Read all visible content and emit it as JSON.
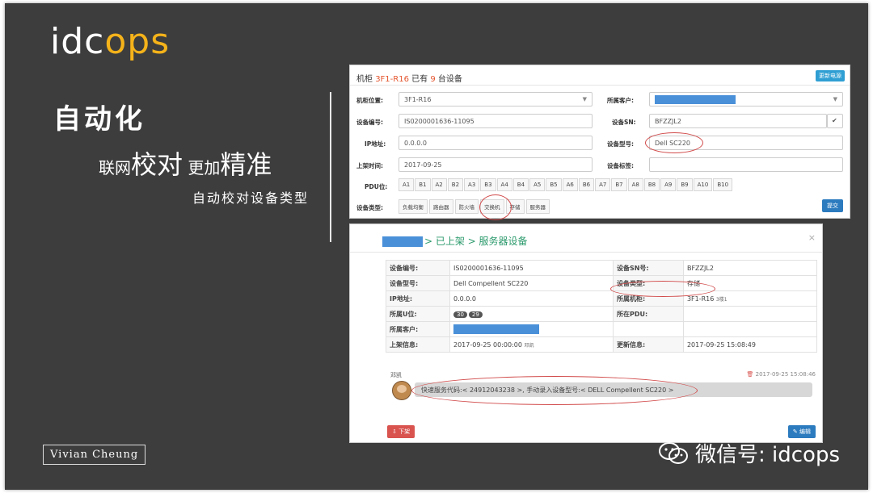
{
  "slide": {
    "logo_left": "idc",
    "logo_right": "ops",
    "heading": "自动化",
    "subheading_parts": [
      "联网",
      "校对",
      " 更加",
      "精准"
    ],
    "subheading_small": "自动校对设备类型",
    "author": "Vivian Cheung",
    "wechat_label": "微信号: idcops"
  },
  "panel1": {
    "head_prefix": "机柜 ",
    "rack": "3F1-R16",
    "head_mid": " 已有 ",
    "count": "9",
    "head_suffix": " 台设备",
    "update_button": "更新电源",
    "labels": {
      "location": "机柜位置:",
      "customer": "所属客户:",
      "device_no": "设备编号:",
      "device_sn": "设备SN:",
      "ip": "IP地址:",
      "model": "设备型号:",
      "onshelf_time": "上架时间:",
      "tag": "设备标签:",
      "pdu": "PDU位:",
      "device_type": "设备类型:"
    },
    "values": {
      "location": "3F1-R16",
      "device_no": "IS0200001636-11095",
      "device_sn": "BFZZJL2",
      "ip": "0.0.0.0",
      "model": "Dell SC220",
      "onshelf_time": "2017-09-25"
    },
    "pdu_slots": [
      "A1",
      "B1",
      "A2",
      "B2",
      "A3",
      "B3",
      "A4",
      "B4",
      "A5",
      "B5",
      "A6",
      "B6",
      "A7",
      "B7",
      "A8",
      "B8",
      "A9",
      "B9",
      "A10",
      "B10"
    ],
    "device_types": [
      "负载均衡",
      "路由器",
      "防火墙",
      "交换机",
      "存储",
      "服务器"
    ],
    "submit": "提交"
  },
  "panel2": {
    "breadcrumb": "> 已上架 > 服务器设备",
    "close": "×",
    "rows": {
      "device_no_k": "设备编号:",
      "device_no_v": "IS0200001636-11095",
      "sn_k": "设备SN号:",
      "sn_v": "BFZZJL2",
      "model_k": "设备型号:",
      "model_v": "Dell Compellent SC220",
      "type_k": "设备类型:",
      "type_v": "存储",
      "ip_k": "IP地址:",
      "ip_v": "0.0.0.0",
      "rack_k": "所属机柜:",
      "rack_v": "3F1-R16",
      "rack_note": "3楼1",
      "u_k": "所属U位:",
      "u_a": "30",
      "u_b": "29",
      "pdu_k": "所在PDU:",
      "customer_k": "所属客户:",
      "onshelf_k": "上架信息:",
      "onshelf_v": "2017-09-25 00:00:00",
      "onshelf_note": "邓凯",
      "updated_k": "更新信息:",
      "updated_v": "2017-09-25 15:08:49"
    },
    "comment_user": "邓凯",
    "comment_time": "2017-09-25 15:08:46",
    "comment_text": "快速服务代码:< 24912043238 >, 手动录入设备型号:< DELL Compellent SC220 >",
    "down_button": "下架",
    "edit_button": "编辑"
  }
}
